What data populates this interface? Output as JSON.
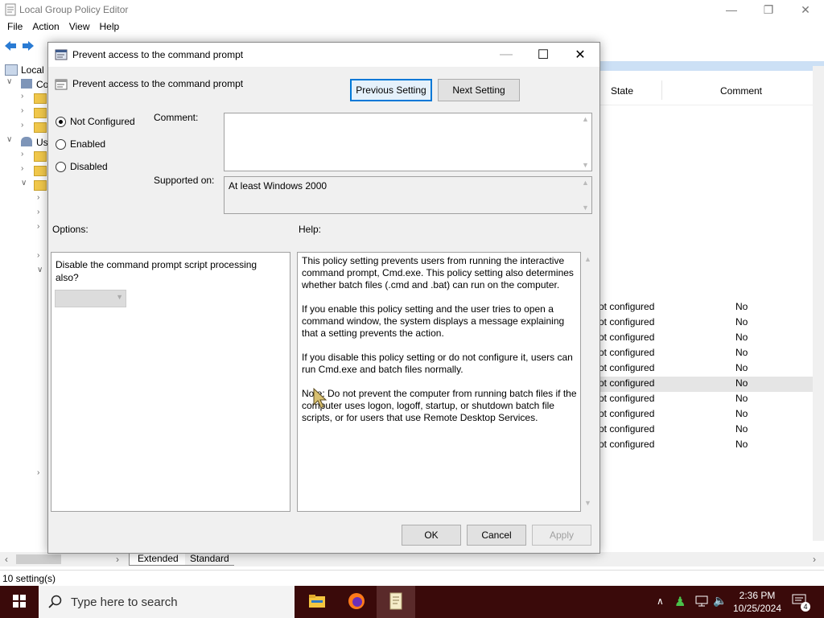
{
  "main": {
    "title": "Local Group Policy Editor",
    "menu": [
      "File",
      "Action",
      "View",
      "Help"
    ],
    "tree_items": [
      {
        "label": "Local",
        "expanded": false
      },
      {
        "label": "Co",
        "expanded": true
      },
      {
        "label": ""
      },
      {
        "label": ""
      },
      {
        "label": ""
      },
      {
        "label": "Us",
        "expanded": true
      }
    ],
    "columns": {
      "state": "State",
      "comment": "Comment"
    },
    "rows": [
      {
        "state": "ot configured",
        "comment": "No"
      },
      {
        "state": "ot configured",
        "comment": "No"
      },
      {
        "state": "ot configured",
        "comment": "No"
      },
      {
        "state": "ot configured",
        "comment": "No"
      },
      {
        "state": "ot configured",
        "comment": "No"
      },
      {
        "state": "ot configured",
        "comment": "No"
      },
      {
        "state": "ot configured",
        "comment": "No"
      },
      {
        "state": "ot configured",
        "comment": "No"
      },
      {
        "state": "ot configured",
        "comment": "No"
      },
      {
        "state": "ot configured",
        "comment": "No"
      }
    ],
    "tabs": [
      "Extended",
      "Standard"
    ],
    "status": "10 setting(s)"
  },
  "dialog": {
    "title": "Prevent access to the command prompt",
    "setting_name": "Prevent access to the command prompt",
    "prev_label": "Previous Setting",
    "next_label": "Next Setting",
    "radios": [
      "Not Configured",
      "Enabled",
      "Disabled"
    ],
    "selected_radio": "Not Configured",
    "comment_label": "Comment:",
    "comment_value": "",
    "supported_label": "Supported on:",
    "supported_value": "At least Windows 2000",
    "options_label": "Options:",
    "help_label": "Help:",
    "option_text": "Disable the command prompt script processing also?",
    "option_select_value": "",
    "help_paragraphs": [
      "This policy setting prevents users from running the interactive command prompt, Cmd.exe.  This policy setting also determines whether batch files (.cmd and .bat) can run on the computer.",
      "If you enable this policy setting and the user tries to open a command window, the system displays a message explaining that a setting prevents the action.",
      "If you disable this policy setting or do not configure it, users can run Cmd.exe and batch files normally.",
      "Note: Do not prevent the computer from running batch files if the computer uses logon, logoff, startup, or shutdown batch file scripts, or for users that use Remote Desktop Services."
    ],
    "ok_label": "OK",
    "cancel_label": "Cancel",
    "apply_label": "Apply"
  },
  "taskbar": {
    "search_placeholder": "Type here to search",
    "time": "2:36 PM",
    "date": "10/25/2024",
    "notification_count": "4"
  }
}
